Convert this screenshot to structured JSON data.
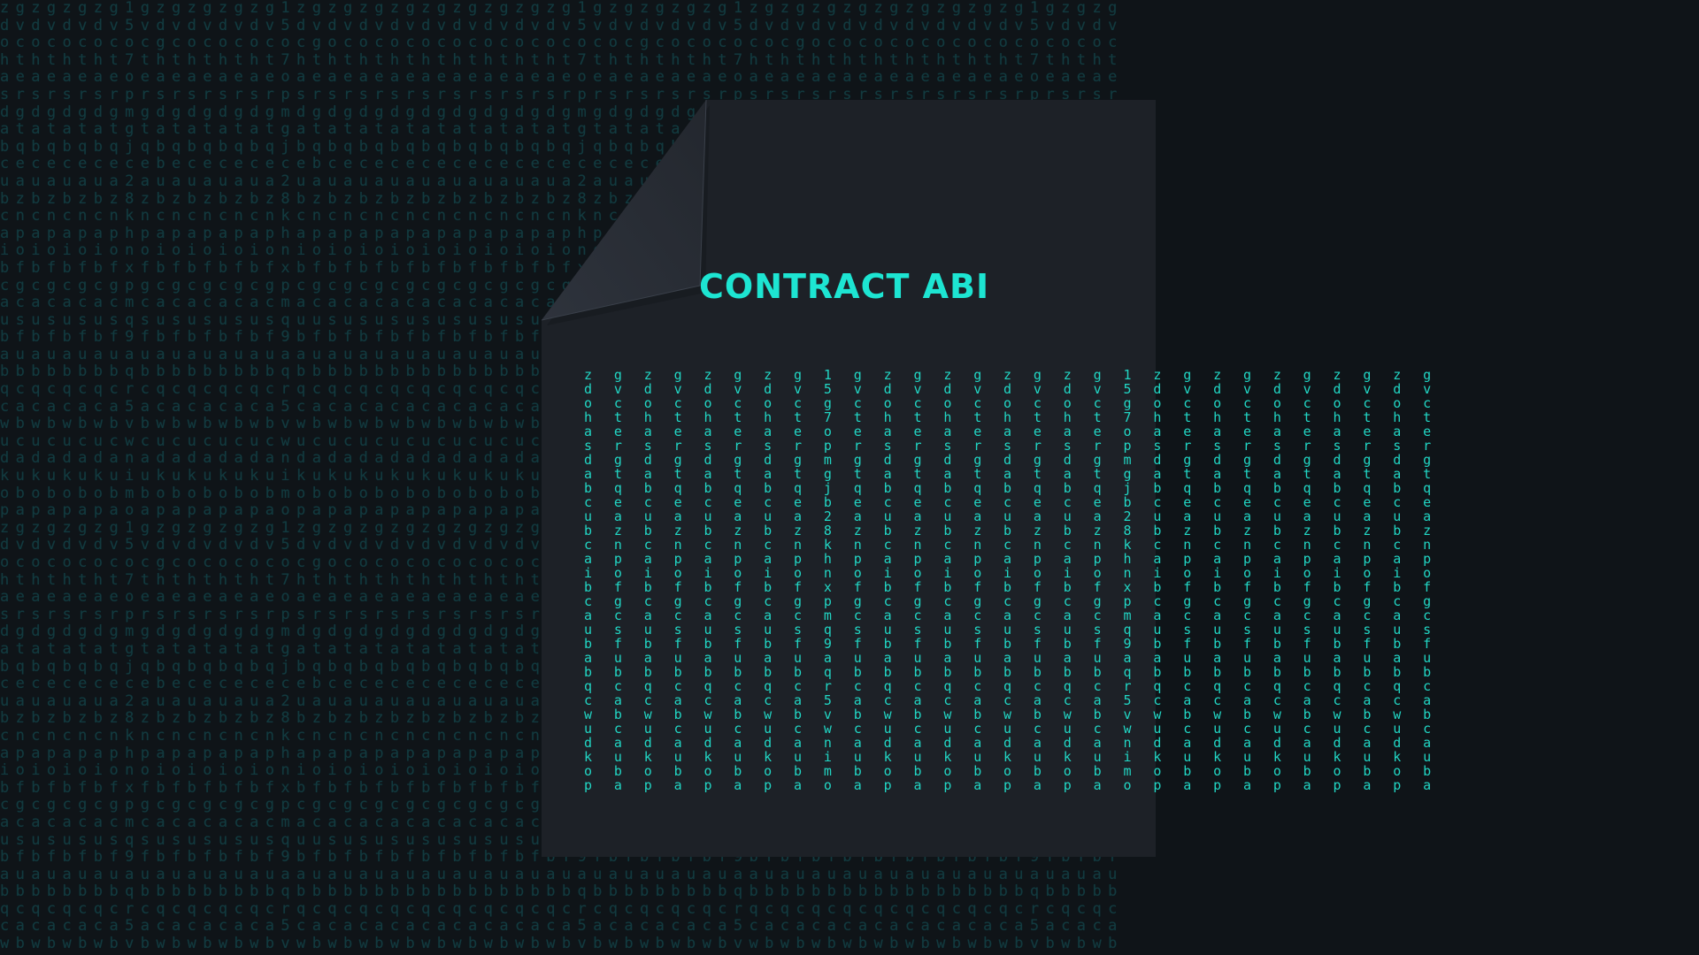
{
  "document": {
    "title": "CONTRACT ABI",
    "text": "z g z g z g z g 1 g z g z g z g z g 1 z g z g z g z g z g\nd v d v d v d v 5 v d v d v d v d v 5 d v d v d v d v d v\no c o c o c o c g c o c o c o c o c g o c o c o c o c o c\nh t h t h t h t 7 t h t h t h t h t 7 h t h t h t h t h t\na e a e a e a e o e a e a e a e a e o a e a e a e a e a e\ns r s r s r s r p r s r s r s r s r p s r s r s r s r s r\nd g d g d g d g m g d g d g d g d g m d g d g d g d g d g\na t a t a t a t g t a t a t a t a t g a t a t a t a t a t\nb q b q b q b q j q b q b q b q b q j b q b q b q b q b q\nc e c e c e c e b e c e c e c e c e b c e c e c e c e c e\nu a u a u a u a 2 a u a u a u a u a 2 u a u a u a u a u a\nb z b z b z b z 8 z b z b z b z b z 8 b z b z b z b z b z\nc n c n c n c n k n c n c n c n c n k c n c n c n c n c n\na p a p a p a p h p a p a p a p a p h a p a p a p a p a p\ni o i o i o i o n o i o i o i o i o n i o i o i o i o i o\nb f b f b f b f x f b f b f b f b f x b f b f b f b f b f\nc g c g c g c g p g c g c g c g c g p c g c g c g c g c g\na c a c a c a c m c a c a c a c a c m a c a c a c a c a c\nu s u s u s u s q s u s u s u s u s q u s u s u s u s u s\nb f b f b f b f 9 f b f b f b f b f 9 b f b f b f b f b f\na u a u a u a u a u a u a u a u a u a a u a u a u a u a u\nb b b b b b b b q b b b b b b b b b q b b b b b b b b b b\nq c q c q c q c r c q c q c q c q c r q c q c q c q c q c\nc a c a c a c a 5 a c a c a c a c a 5 c a c a c a c a c a\nw b w b w b w b v b w b w b w b w b v w b w b w b w b w b\nu c u c u c u c w c u c u c u c u c w u c u c u c u c u c\nd a d a d a d a n a d a d a d a d a n d a d a d a d a d a\nk u k u k u k u i u k u k u k u k u i k u k u k u k u k u\no b o b o b o b m b o b o b o b o b m o b o b o b o b o b\np a p a p a p a o a p a p a p a p a o p a p a p a p a p a"
  },
  "background": {
    "rows": [
      "zgzgzgzg1gzgzgzgzg1zgzgzgzgzg",
      "dvdvdvdv5vdvdvdvdv5dvdvdvdvdv",
      "ocococococgcococococgocococococ",
      "hthththt7ththththt7hththththt",
      "aeaeaeaeoeaeaeaeaeoaeaeaeaeae",
      "srsrsrsrprsrsrsrsrpsrsrsrsrsr",
      "dgdgdgdgmgdgdgdgdgmdgdgdgdgdg",
      "atatatatgtatatatatgatatatatat",
      "bqbqbqbqjqbqbqbqbqjbqbqbqbqbq",
      "cececececebececececebcececececece",
      "uauauaua2auauauaua2uauauauaua",
      "bzbzbzbz8zbzbzbzbz8bzbzbzbzbz",
      "cncncncnkncncncncnkcncncncncn",
      "apapapaphpapapapaphapapapapap",
      "ioioioionoioioioionioioioioio",
      "bfbfbfbfxfbfbfbfbfxbfbfbfbfbf",
      "cgcgcgcgpgcgcgcgcgpcgcgcgcgcg",
      "acacacacmcacacacacmacacacacac",
      "ususususqsususususquusususus",
      "bfbfbfbf9fbfbfbfbf9bfbfbfbfbf",
      "auauauauauauauauauaauauauauau",
      "bbbbbbbbqbbbbbbbbbqbbbbbbbbbb",
      "qcqcqcqcrcqcqcqcqcrqcqcqcqcqc",
      "cacacaca5acacacaca5cacacacaca",
      "wbwbwbwbvbwbwbwbwbvwbwbwbwbwb",
      "ucucucucwcucucucucwucucucucuc",
      "dadadadanadadadadandadadadada",
      "kukukukuiukukukukuikukukukuku",
      "obobobobmbobobobobmobobobobob",
      "papapapaoapapapapaopapapapapa"
    ]
  },
  "colors": {
    "background": "#0f1418",
    "page": "#1d2127",
    "fold_light": "#2c313a",
    "fold_dark": "#1b1f25",
    "accent": "#1de5d2",
    "background_text": "#123a3f"
  }
}
